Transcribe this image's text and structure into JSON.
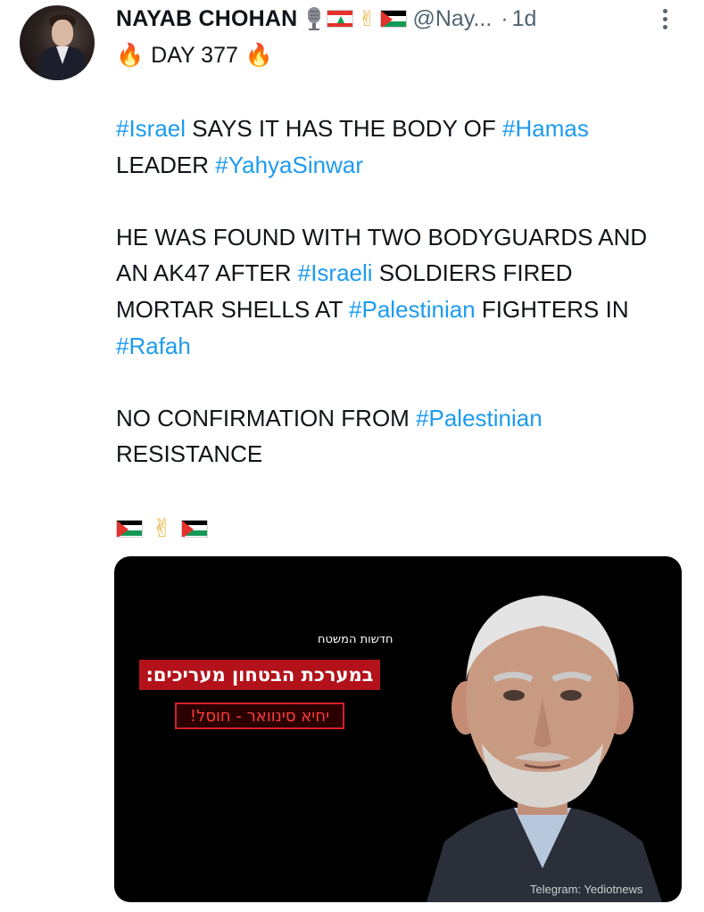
{
  "tweet": {
    "author_name": "NAYAB CHOHAN",
    "handle": "@Nay...",
    "separator": "·",
    "time": "1d",
    "name_badges": [
      "microphone-icon",
      "lebanon-flag",
      "victory-hand",
      "palestine-flag"
    ],
    "day_line": {
      "left_emoji": "🔥",
      "text": "DAY 377",
      "right_emoji": "🔥"
    },
    "paragraphs": [
      [
        {
          "text": "#Israel",
          "hashtag": true
        },
        {
          "text": " SAYS IT HAS THE BODY OF ",
          "hashtag": false
        },
        {
          "text": "#Hamas",
          "hashtag": true
        },
        {
          "text": " LEADER ",
          "hashtag": false
        },
        {
          "text": "#YahyaSinwar",
          "hashtag": true
        }
      ],
      [
        {
          "text": "HE WAS FOUND WITH TWO BODYGUARDS AND AN AK47 AFTER ",
          "hashtag": false
        },
        {
          "text": "#Israeli",
          "hashtag": true
        },
        {
          "text": " SOLDIERS FIRED MORTAR SHELLS AT ",
          "hashtag": false
        },
        {
          "text": "#Palestinian",
          "hashtag": true
        },
        {
          "text": " FIGHTERS IN ",
          "hashtag": false
        },
        {
          "text": "#Rafah",
          "hashtag": true
        }
      ],
      [
        {
          "text": "NO CONFIRMATION FROM ",
          "hashtag": false
        },
        {
          "text": "#Palestinian",
          "hashtag": true
        },
        {
          "text": " RESISTANCE",
          "hashtag": false
        }
      ]
    ],
    "flags_row": [
      "palestine-flag",
      "victory-hand",
      "palestine-flag"
    ],
    "victory_emoji": "✌",
    "media": {
      "news_label": "חדשות המשטח",
      "headline": "במערכת הבטחון מעריכים:",
      "subheadline": "יחיא סינוואר - חוסל!",
      "watermark": "Telegram: Yediotnews"
    }
  },
  "colors": {
    "text": "#0f1419",
    "muted": "#536471",
    "hashtag": "#1d9bf0",
    "media_bg": "#000000",
    "headline_red": "#b3121b"
  }
}
